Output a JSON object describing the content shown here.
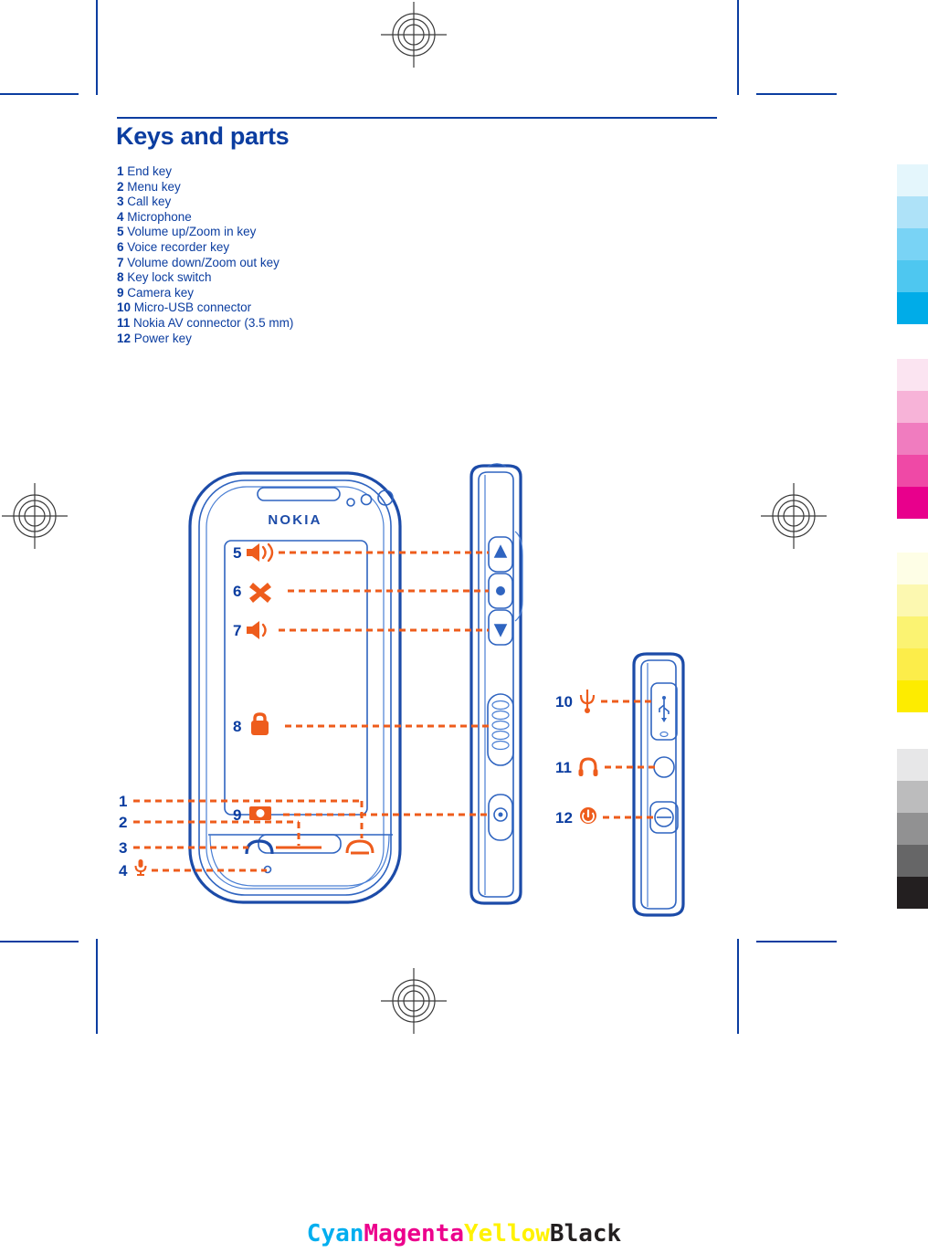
{
  "page": {
    "heading": "Keys and parts",
    "accent_blue": "#0b3da0",
    "accent_orange": "#ee5c1c",
    "line_blue": "#1c4ba8"
  },
  "parts_list": [
    {
      "num": "1",
      "label": "End key"
    },
    {
      "num": "2",
      "label": "Menu key"
    },
    {
      "num": "3",
      "label": "Call key"
    },
    {
      "num": "4",
      "label": "Microphone"
    },
    {
      "num": "5",
      "label": "Volume up/Zoom in key"
    },
    {
      "num": "6",
      "label": "Voice recorder key"
    },
    {
      "num": "7",
      "label": "Volume down/Zoom out key"
    },
    {
      "num": "8",
      "label": "Key lock switch"
    },
    {
      "num": "9",
      "label": "Camera key"
    },
    {
      "num": "10",
      "label": "Micro-USB connector"
    },
    {
      "num": "11",
      "label": "Nokia AV connector (3.5 mm)"
    },
    {
      "num": "12",
      "label": "Power key"
    }
  ],
  "diagram": {
    "device_brand": "NOKIA",
    "front_callouts": [
      {
        "num": "1",
        "icon": "none"
      },
      {
        "num": "2",
        "icon": "none"
      },
      {
        "num": "3",
        "icon": "none"
      },
      {
        "num": "4",
        "icon": "microphone-icon"
      }
    ],
    "side_callouts": [
      {
        "num": "5",
        "icon": "speaker-loud-icon"
      },
      {
        "num": "6",
        "icon": "voice-recorder-x-icon"
      },
      {
        "num": "7",
        "icon": "speaker-quiet-icon"
      },
      {
        "num": "8",
        "icon": "lock-icon"
      },
      {
        "num": "9",
        "icon": "camera-icon"
      }
    ],
    "top_callouts": [
      {
        "num": "10",
        "icon": "usb-icon"
      },
      {
        "num": "11",
        "icon": "headphone-icon"
      },
      {
        "num": "12",
        "icon": "power-icon"
      }
    ]
  },
  "color_bars": {
    "cyan": [
      "#e4f6fc",
      "#aee2f8",
      "#79d3f5",
      "#4ec7f0",
      "#00ace8"
    ],
    "magenta": [
      "#fbe4f1",
      "#f7b3d8",
      "#f07cbf",
      "#ef49a6",
      "#e8008c"
    ],
    "yellow": [
      "#fefee6",
      "#fcf8b0",
      "#fbf372",
      "#fced4a",
      "#fdec00"
    ],
    "black": [
      "#e7e7e8",
      "#bcbcbd",
      "#919192",
      "#666667",
      "#231f20"
    ]
  },
  "cmyk_labels": [
    {
      "text": "Cyan",
      "color": "#00aeef"
    },
    {
      "text": "Magenta",
      "color": "#ec008c"
    },
    {
      "text": "Yellow",
      "color": "#fff200"
    },
    {
      "text": "Black",
      "color": "#231f20"
    }
  ]
}
